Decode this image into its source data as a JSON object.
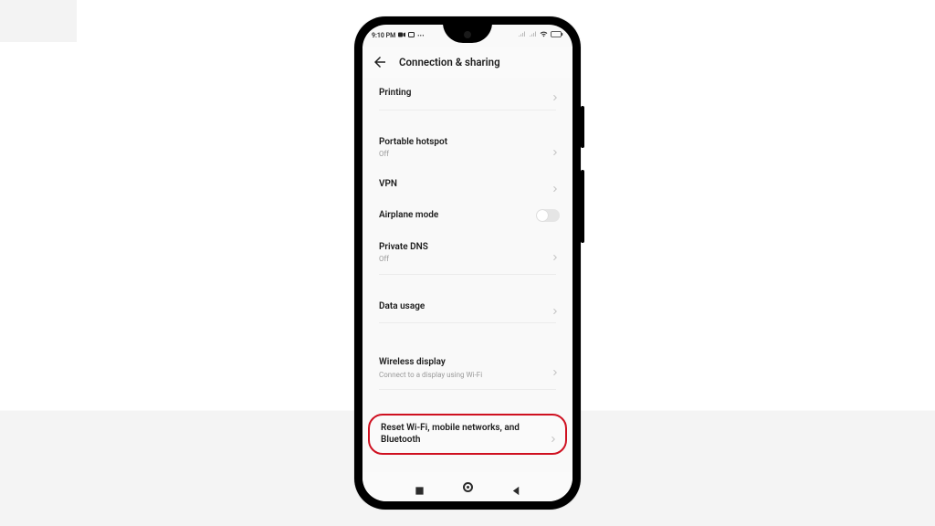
{
  "statusbar": {
    "time": "9:10 PM"
  },
  "header": {
    "title": "Connection & sharing"
  },
  "rows": {
    "printing": {
      "label": "Printing"
    },
    "hotspot": {
      "label": "Portable hotspot",
      "sub": "Off"
    },
    "vpn": {
      "label": "VPN"
    },
    "airplane": {
      "label": "Airplane mode"
    },
    "privatedns": {
      "label": "Private DNS",
      "sub": "Off"
    },
    "datausage": {
      "label": "Data usage"
    },
    "wirelessdisplay": {
      "label": "Wireless display",
      "sub": "Connect to a display using Wi-Fi"
    },
    "reset": {
      "label": "Reset Wi-Fi, mobile networks, and Bluetooth"
    }
  }
}
